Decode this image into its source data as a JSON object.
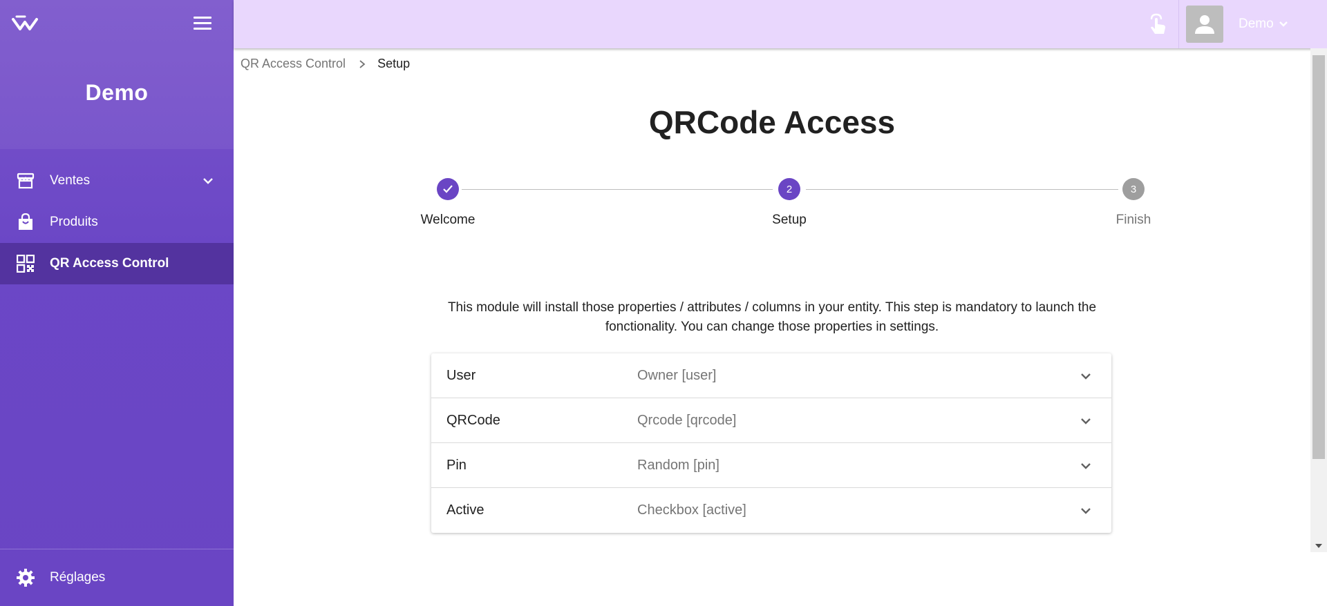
{
  "sidebar": {
    "brand": "Demo",
    "items": [
      {
        "label": "Ventes",
        "icon": "store-icon",
        "expandable": true
      },
      {
        "label": "Produits",
        "icon": "shopping-bag-icon"
      },
      {
        "label": "QR Access Control",
        "icon": "qr-code-icon",
        "active": true
      }
    ],
    "footer_label": "Réglages"
  },
  "topbar": {
    "user_name": "Demo"
  },
  "breadcrumb": {
    "parent": "QR Access Control",
    "current": "Setup"
  },
  "page": {
    "title": "QRCode Access",
    "description": "This module will install those properties / attributes / columns in your entity. This step is mandatory to launch the fonctionality. You can change those properties in settings."
  },
  "stepper": {
    "steps": [
      {
        "label": "Welcome",
        "marker": "",
        "state": "done"
      },
      {
        "label": "Setup",
        "marker": "2",
        "state": "active"
      },
      {
        "label": "Finish",
        "marker": "3",
        "state": "pending"
      }
    ]
  },
  "properties": [
    {
      "key": "User",
      "value": "Owner [user]"
    },
    {
      "key": "QRCode",
      "value": "Qrcode [qrcode]"
    },
    {
      "key": "Pin",
      "value": "Random [pin]"
    },
    {
      "key": "Active",
      "value": "Checkbox [active]"
    }
  ],
  "colors": {
    "primary": "#6a45c4",
    "active_nav": "#53339f",
    "topbar": "#e9d7fd",
    "pending_step": "#9e9e9e"
  }
}
